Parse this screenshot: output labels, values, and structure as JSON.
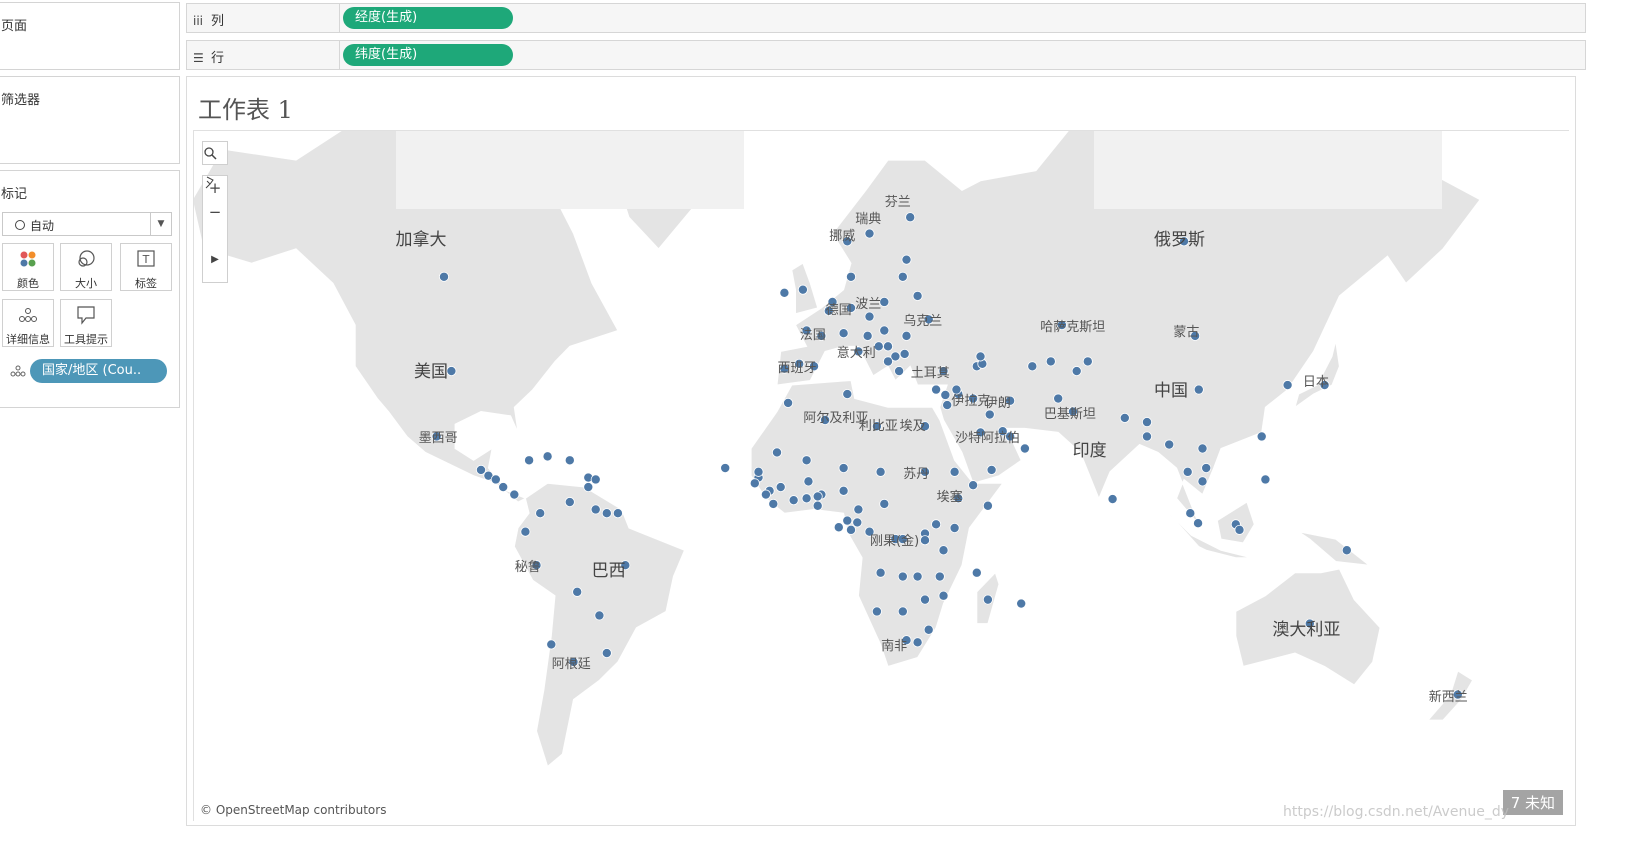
{
  "left_panel": {
    "pages_title": "页面",
    "filters_title": "筛选器",
    "marks_title": "标记",
    "mark_type": "自动",
    "mark_buttons": {
      "color": "颜色",
      "size": "大小",
      "label": "标签",
      "detail": "详细信息",
      "tooltip": "工具提示"
    },
    "detail_field": "国家/地区 (Cou.."
  },
  "shelves": {
    "columns_label": "列",
    "columns_pill": "经度(生成)",
    "rows_label": "行",
    "rows_pill": "纬度(生成)"
  },
  "worksheet": {
    "title": "工作表 1",
    "attribution": "© OpenStreetMap contributors",
    "corner_badge": "7 未知",
    "watermark": "https://blog.csdn.net/Avenue_dy"
  },
  "map_labels": {
    "canada": "加拿大",
    "usa": "美国",
    "mexico": "墨西哥",
    "brazil": "巴西",
    "peru": "秘鲁",
    "argentina": "阿根廷",
    "russia": "俄罗斯",
    "china": "中国",
    "india": "印度",
    "kazakhstan": "哈萨克斯坦",
    "mongolia": "蒙古",
    "japan": "日本",
    "pakistan": "巴基斯坦",
    "australia": "澳大利亚",
    "new_zealand": "新西兰",
    "algeria": "阿尔及利亚",
    "libya": "利比亚",
    "egypt": "埃及",
    "sudan": "苏丹",
    "saudi": "沙特阿拉伯",
    "turkey": "土耳其",
    "iraq": "伊拉克",
    "iran": "伊朗",
    "ukraine": "乌克兰",
    "italy": "意大利",
    "spain": "西班牙",
    "france": "法国",
    "germany": "德国",
    "poland": "波兰",
    "norway": "挪威",
    "sweden": "瑞典",
    "finland": "芬兰",
    "congo": "刚果(金)",
    "south_africa": "南非",
    "ethiopia": "埃塞"
  },
  "colors": {
    "mark": "#4e79a7",
    "pill_green": "#1ea879",
    "pill_blue": "#4d97b8",
    "land": "#e6e6e6",
    "border": "#ffffff"
  },
  "points": [
    [
      -100,
      56
    ],
    [
      -98,
      39
    ],
    [
      -102,
      24
    ],
    [
      -90,
      15.5
    ],
    [
      -88,
      14
    ],
    [
      -86,
      13
    ],
    [
      -84,
      11
    ],
    [
      -81,
      9
    ],
    [
      -77,
      18
    ],
    [
      -72,
      19
    ],
    [
      -66,
      18
    ],
    [
      -61,
      13.5
    ],
    [
      -61,
      11
    ],
    [
      -59,
      13
    ],
    [
      -78,
      -1
    ],
    [
      -74,
      4
    ],
    [
      -66,
      7
    ],
    [
      -59,
      5
    ],
    [
      -56,
      4
    ],
    [
      -53,
      4
    ],
    [
      -51,
      -10
    ],
    [
      -58,
      -23
    ],
    [
      -64,
      -17
    ],
    [
      -75,
      -10
    ],
    [
      -56,
      -32
    ],
    [
      -65,
      -34
    ],
    [
      -71,
      -30
    ],
    [
      -8,
      53.5
    ],
    [
      -3,
      54
    ],
    [
      -2,
      47
    ],
    [
      2,
      46
    ],
    [
      0,
      40
    ],
    [
      -8,
      39.5
    ],
    [
      -4,
      40.5
    ],
    [
      4,
      50.5
    ],
    [
      5,
      52
    ],
    [
      10,
      51
    ],
    [
      10,
      56
    ],
    [
      9,
      61
    ],
    [
      15,
      62
    ],
    [
      26,
      64
    ],
    [
      25,
      58.5
    ],
    [
      24,
      56
    ],
    [
      19,
      52
    ],
    [
      15,
      49.5
    ],
    [
      19,
      47
    ],
    [
      25,
      46
    ],
    [
      14.5,
      46
    ],
    [
      8,
      46.5
    ],
    [
      12,
      43
    ],
    [
      17.5,
      44
    ],
    [
      20,
      44
    ],
    [
      22,
      42
    ],
    [
      20,
      41
    ],
    [
      23,
      39
    ],
    [
      24.5,
      42.5
    ],
    [
      31,
      49
    ],
    [
      28,
      53
    ],
    [
      35,
      39
    ],
    [
      33,
      35
    ],
    [
      39,
      34
    ],
    [
      44,
      40
    ],
    [
      45.5,
      40.5
    ],
    [
      43,
      33
    ],
    [
      53,
      32.5
    ],
    [
      45,
      25
    ],
    [
      53,
      24
    ],
    [
      51,
      25.3
    ],
    [
      47.5,
      29.3
    ],
    [
      57,
      21
    ],
    [
      48,
      15.5
    ],
    [
      36,
      31.5
    ],
    [
      35.5,
      33.8
    ],
    [
      38.5,
      35
    ],
    [
      45,
      42
    ],
    [
      67,
      48
    ],
    [
      74,
      41
    ],
    [
      71,
      39
    ],
    [
      59,
      40
    ],
    [
      64,
      41
    ],
    [
      66,
      33
    ],
    [
      70,
      30
    ],
    [
      84,
      28.5
    ],
    [
      90,
      27.5
    ],
    [
      90,
      24
    ],
    [
      80.7,
      7.8
    ],
    [
      96,
      22
    ],
    [
      101,
      15
    ],
    [
      105,
      12.5
    ],
    [
      106,
      16
    ],
    [
      105,
      21
    ],
    [
      103.8,
      1.3
    ],
    [
      101.7,
      4
    ],
    [
      114,
      1
    ],
    [
      115,
      -0.5
    ],
    [
      122,
      13
    ],
    [
      121,
      24
    ],
    [
      104,
      35
    ],
    [
      103,
      46
    ],
    [
      100,
      61
    ],
    [
      138,
      36
    ],
    [
      128,
      36
    ],
    [
      144,
      -6
    ],
    [
      134,
      -25
    ],
    [
      174,
      -41
    ],
    [
      3,
      28
    ],
    [
      -7,
      32
    ],
    [
      9,
      34
    ],
    [
      17,
      26.5
    ],
    [
      30,
      26.5
    ],
    [
      30,
      15
    ],
    [
      39,
      8
    ],
    [
      47,
      6
    ],
    [
      43,
      11.5
    ],
    [
      38,
      15
    ],
    [
      -15,
      13.5
    ],
    [
      -12,
      10
    ],
    [
      -16,
      12
    ],
    [
      -13,
      9
    ],
    [
      -11,
      6.5
    ],
    [
      -5.5,
      7.5
    ],
    [
      -1.5,
      12.5
    ],
    [
      2,
      9
    ],
    [
      1,
      8.5
    ],
    [
      1,
      6
    ],
    [
      8,
      10
    ],
    [
      -2,
      8
    ],
    [
      -9,
      11
    ],
    [
      -2,
      18
    ],
    [
      8,
      16
    ],
    [
      -10,
      20
    ],
    [
      -15,
      15
    ],
    [
      18,
      15
    ],
    [
      19,
      6.5
    ],
    [
      12,
      5
    ],
    [
      9,
      2
    ],
    [
      10,
      -0.5
    ],
    [
      11.7,
      1.5
    ],
    [
      15,
      -1
    ],
    [
      22,
      -3
    ],
    [
      24,
      -3
    ],
    [
      30,
      -1.5
    ],
    [
      30,
      -3.3
    ],
    [
      33,
      1
    ],
    [
      38,
      0
    ],
    [
      35,
      -6
    ],
    [
      28,
      -13
    ],
    [
      24,
      -13
    ],
    [
      18,
      -12
    ],
    [
      34,
      -13
    ],
    [
      30,
      -19
    ],
    [
      24,
      -22
    ],
    [
      17,
      -22
    ],
    [
      31,
      -26.5
    ],
    [
      28,
      -29.5
    ],
    [
      25,
      -29
    ],
    [
      47,
      -19
    ],
    [
      35,
      -18
    ],
    [
      56,
      -20
    ],
    [
      -24,
      16
    ],
    [
      6.7,
      0.2
    ],
    [
      44,
      -12
    ]
  ]
}
